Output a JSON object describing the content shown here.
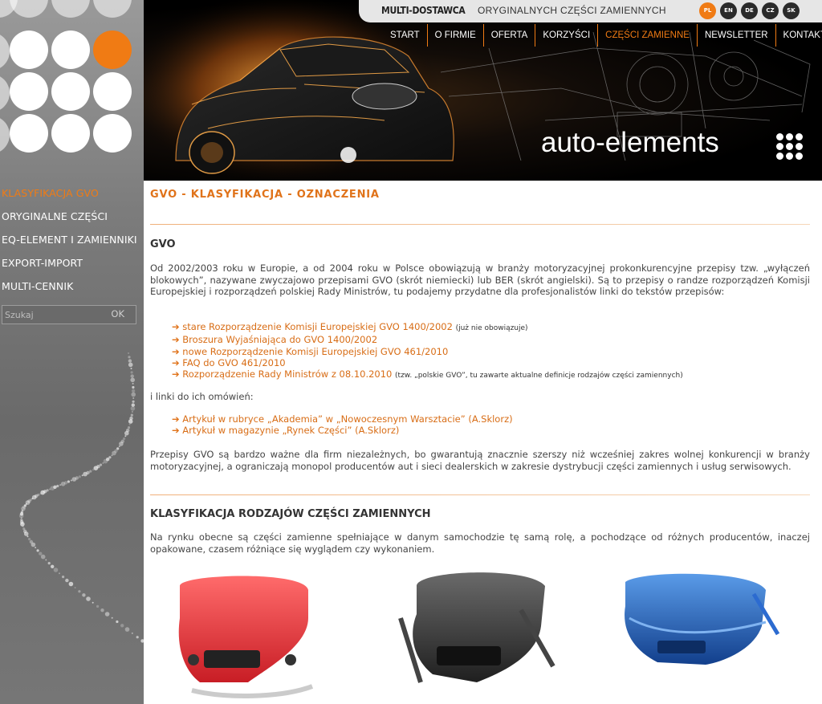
{
  "site": {
    "brand": "MULTI-DOSTAWCA",
    "tagline": "ORYGINALNYCH CZĘŚCI ZAMIENNYCH",
    "logo_text": "auto-elements"
  },
  "languages": [
    {
      "code": "PL",
      "active": true
    },
    {
      "code": "EN",
      "active": false
    },
    {
      "code": "DE",
      "active": false
    },
    {
      "code": "CZ",
      "active": false
    },
    {
      "code": "SK",
      "active": false
    }
  ],
  "menu": [
    {
      "label": "START"
    },
    {
      "label": "O FIRMIE"
    },
    {
      "label": "OFERTA"
    },
    {
      "label": "KORZYŚCI"
    },
    {
      "label": "CZĘŚCI ZAMIENNE",
      "active": true
    },
    {
      "label": "NEWSLETTER"
    },
    {
      "label": "KONTAKT"
    }
  ],
  "sidebar": {
    "items": [
      {
        "label": "KLASYFIKACJA GVO",
        "active": true
      },
      {
        "label": "ORYGINALNE CZĘŚCI"
      },
      {
        "label": "EQ-ELEMENT I ZAMIENNIKI"
      },
      {
        "label": "EXPORT-IMPORT"
      },
      {
        "label": "MULTI-CENNIK"
      }
    ],
    "search_placeholder": "Szukaj",
    "search_button": "OK"
  },
  "content": {
    "title": "GVO - KLASYFIKACJA - OZNACZENIA",
    "section1_heading": "GVO",
    "section1_para": "Od 2002/2003 roku w Europie, a od 2004 roku w Polsce obowiązują w branży motoryzacyjnej prokonkurencyjne przepisy tzw. „wyłączeń blokowych”, nazywane zwyczajowo przepisami GVO (skrót niemiecki) lub BER (skrót angielski). Są to przepisy o randze rozporządzeń Komisji Europejskiej i rozporządzeń polskiej Rady Ministrów, tu podajemy przydatne dla profesjonalistów linki do tekstów przepisów:",
    "links1": [
      {
        "text": "stare Rozporządzenie Komisji Europejskiej GVO 1400/2002",
        "note": "(już nie obowiązuje)"
      },
      {
        "text": "Broszura Wyjaśniająca do GVO 1400/2002",
        "note": ""
      },
      {
        "text": "nowe Rozporządzenie Komisji Europejskiej GVO 461/2010",
        "note": ""
      },
      {
        "text": "FAQ do GVO 461/2010",
        "note": ""
      },
      {
        "text": "Rozporządzenie Rady Ministrów z 08.10.2010",
        "note": "(tzw. „polskie GVO”, tu zawarte aktualne definicje rodzajów części zamiennych)"
      }
    ],
    "links_intro": "i linki do ich omówień:",
    "links2": [
      {
        "text": "Artykuł w rubryce „Akademia” w „Nowoczesnym Warsztacie” (A.Sklorz)"
      },
      {
        "text": "Artykuł w magazynie „Rynek Części” (A.Sklorz)"
      }
    ],
    "section1_para2": "Przepisy GVO są bardzo ważne dla firm niezależnych, bo gwarantują znacznie szerszy niż wcześniej zakres wolnej konkurencji w branży motoryzacyjnej, a ograniczają monopol producentów aut i sieci dealerskich w zakresie dystrybucji części zamiennych i usług serwisowych.",
    "section2_heading": "KLASYFIKACJA RODZAJÓW CZĘŚCI ZAMIENNYCH",
    "section2_para": "Na rynku obecne są części zamienne spełniające w danym samochodzie tę samą rolę, a pochodzące od różnych producentów, inaczej opakowane, czasem różniące się wyglądem czy wykonaniem."
  },
  "colors": {
    "accent": "#f07b14",
    "link": "#d86d16",
    "bumper_red": "#e8333a",
    "bumper_carbon": "#3a3a3a",
    "bumper_blue": "#1f5fc0"
  }
}
